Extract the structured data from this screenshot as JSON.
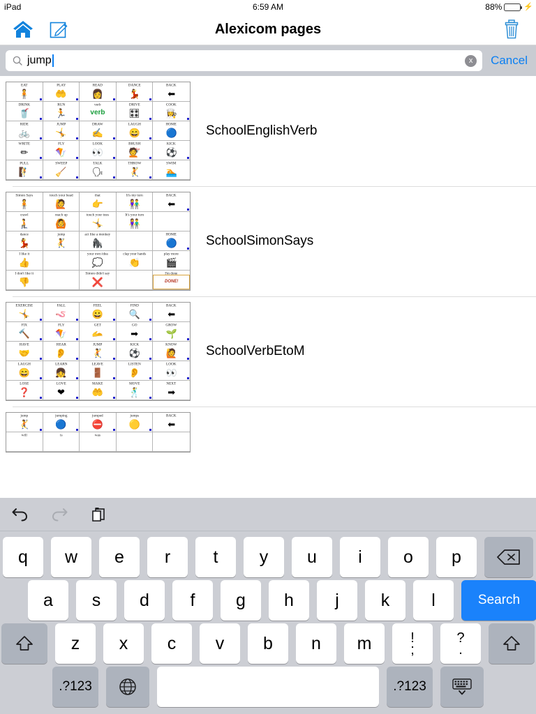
{
  "status_bar": {
    "device": "iPad",
    "time": "6:59 AM",
    "battery_percent": "88%",
    "charging_icon": "lightning-bolt-icon"
  },
  "nav_bar": {
    "title": "Alexicom pages",
    "home_icon": "home-icon",
    "edit_icon": "edit-compose-icon",
    "delete_icon": "trash-icon"
  },
  "search": {
    "value": "jump",
    "placeholder": "Search",
    "search_icon": "search-icon",
    "clear_icon": "clear-circle-icon",
    "clear_label": "x",
    "cancel_label": "Cancel"
  },
  "results": [
    {
      "title": "SchoolEnglishVerb",
      "cells": [
        {
          "label": "EAT",
          "art": "🧍",
          "dot": true
        },
        {
          "label": "PLAY",
          "art": "🤲",
          "dot": true
        },
        {
          "label": "READ",
          "art": "👩",
          "dot": true
        },
        {
          "label": "DANCE",
          "art": "💃",
          "dot": true
        },
        {
          "label": "BACK",
          "art": "⬅",
          "dot": false
        },
        {
          "label": "DRINK",
          "art": "🥤",
          "dot": true
        },
        {
          "label": "RUN",
          "art": "🏃",
          "dot": true
        },
        {
          "label": "verb",
          "art": "verb",
          "dot": false
        },
        {
          "label": "DRIVE",
          "art": "🎛",
          "dot": true
        },
        {
          "label": "COOK",
          "art": "👩‍🍳",
          "dot": true
        },
        {
          "label": "RIDE",
          "art": "🚲",
          "dot": true
        },
        {
          "label": "JUMP",
          "art": "🤸",
          "dot": true
        },
        {
          "label": "DRAW",
          "art": "✍",
          "dot": true
        },
        {
          "label": "LAUGH",
          "art": "😄",
          "dot": true
        },
        {
          "label": "HOME",
          "art": "🔵",
          "dot": false
        },
        {
          "label": "WRITE",
          "art": "✏",
          "dot": true
        },
        {
          "label": "FLY",
          "art": "🪁",
          "dot": true
        },
        {
          "label": "LOOK",
          "art": "👀",
          "dot": true
        },
        {
          "label": "BRUSH",
          "art": "💇",
          "dot": true
        },
        {
          "label": "KICK",
          "art": "⚽",
          "dot": true
        },
        {
          "label": "PULL",
          "art": "🧗",
          "dot": true
        },
        {
          "label": "SWEEP",
          "art": "🧹",
          "dot": true
        },
        {
          "label": "TALK",
          "art": "🗣",
          "dot": true
        },
        {
          "label": "THROW",
          "art": "🤾",
          "dot": true
        },
        {
          "label": "SWIM",
          "art": "🏊",
          "dot": false
        }
      ]
    },
    {
      "title": "SchoolSimonSays",
      "cells": [
        {
          "label": "Simon Says",
          "art": "🧍",
          "dot": false
        },
        {
          "label": "touch your head",
          "art": "🙋",
          "dot": false
        },
        {
          "label": "that",
          "art": "👉",
          "dot": false
        },
        {
          "label": "It's my turn",
          "art": "👫",
          "dot": false
        },
        {
          "label": "BACK",
          "art": "⬅",
          "dot": true
        },
        {
          "label": "crawl",
          "art": "🧎",
          "dot": false
        },
        {
          "label": "reach up",
          "art": "🙆",
          "dot": false
        },
        {
          "label": "touch your toes",
          "art": "🤸",
          "dot": false
        },
        {
          "label": "It's your turn",
          "art": "👫",
          "dot": false
        },
        {
          "label": "",
          "art": "",
          "dot": false
        },
        {
          "label": "dance",
          "art": "💃",
          "dot": false
        },
        {
          "label": "jump",
          "art": "🤾",
          "dot": false
        },
        {
          "label": "act like a monkey",
          "art": "🦍",
          "dot": false
        },
        {
          "label": "",
          "art": "",
          "dot": false
        },
        {
          "label": "HOME",
          "art": "🔵",
          "dot": true
        },
        {
          "label": "I like it",
          "art": "👍",
          "dot": false
        },
        {
          "label": "",
          "art": "",
          "dot": false
        },
        {
          "label": "your own idea",
          "art": "💭",
          "dot": false
        },
        {
          "label": "clap your hands",
          "art": "👏",
          "dot": false
        },
        {
          "label": "play more",
          "art": "🎬",
          "dot": false
        },
        {
          "label": "I don't like it",
          "art": "👎",
          "dot": false
        },
        {
          "label": "",
          "art": "",
          "dot": false
        },
        {
          "label": "Simon didn't say",
          "art": "❌",
          "dot": false
        },
        {
          "label": "",
          "art": "",
          "dot": false
        },
        {
          "label": "I'm done",
          "art": "DONE!",
          "dot": false
        }
      ]
    },
    {
      "title": "SchoolVerbEtoM",
      "cells": [
        {
          "label": "EXERCISE",
          "art": "🤸",
          "dot": true
        },
        {
          "label": "FALL",
          "art": "🪱",
          "dot": true
        },
        {
          "label": "FEEL",
          "art": "😀",
          "dot": true
        },
        {
          "label": "FIND",
          "art": "🔍",
          "dot": true
        },
        {
          "label": "BACK",
          "art": "⬅",
          "dot": false
        },
        {
          "label": "FIX",
          "art": "🔨",
          "dot": true
        },
        {
          "label": "FLY",
          "art": "🪁",
          "dot": true
        },
        {
          "label": "GET",
          "art": "🫴",
          "dot": true
        },
        {
          "label": "GO",
          "art": "➡",
          "dot": true
        },
        {
          "label": "GROW",
          "art": "🌱",
          "dot": true
        },
        {
          "label": "HAVE",
          "art": "🤝",
          "dot": true
        },
        {
          "label": "HEAR",
          "art": "👂",
          "dot": true
        },
        {
          "label": "JUMP",
          "art": "🤾",
          "dot": true
        },
        {
          "label": "KICK",
          "art": "⚽",
          "dot": true
        },
        {
          "label": "KNOW",
          "art": "🙋",
          "dot": true
        },
        {
          "label": "LAUGH",
          "art": "😄",
          "dot": true
        },
        {
          "label": "LEARN",
          "art": "👧",
          "dot": true
        },
        {
          "label": "LEAVE",
          "art": "🚪",
          "dot": true
        },
        {
          "label": "LISTEN",
          "art": "👂",
          "dot": true
        },
        {
          "label": "LOOK",
          "art": "👀",
          "dot": true
        },
        {
          "label": "LOSE",
          "art": "❓",
          "dot": true
        },
        {
          "label": "LOVE",
          "art": "❤",
          "dot": true
        },
        {
          "label": "MAKE",
          "art": "🤲",
          "dot": true
        },
        {
          "label": "MOVE",
          "art": "🕺",
          "dot": true
        },
        {
          "label": "NEXT",
          "art": "➡",
          "dot": false
        }
      ]
    },
    {
      "title": "",
      "cells": [
        {
          "label": "jump",
          "art": "🤾",
          "dot": true
        },
        {
          "label": "jumping",
          "art": "🔵",
          "dot": true
        },
        {
          "label": "jumped",
          "art": "⛔",
          "dot": true
        },
        {
          "label": "jumps",
          "art": "🟡",
          "dot": true
        },
        {
          "label": "BACK",
          "art": "⬅",
          "dot": false
        },
        {
          "label": "will",
          "art": "",
          "dot": false
        },
        {
          "label": "is",
          "art": "",
          "dot": false
        },
        {
          "label": "was",
          "art": "",
          "dot": false
        },
        {
          "label": "",
          "art": "",
          "dot": false
        },
        {
          "label": "",
          "art": "",
          "dot": false
        }
      ]
    }
  ],
  "keyboard": {
    "toolbar": {
      "undo_icon": "undo-arrow-icon",
      "redo_icon": "redo-arrow-icon",
      "paste_icon": "paste-clipboard-icon"
    },
    "row1": [
      "q",
      "w",
      "e",
      "r",
      "t",
      "y",
      "u",
      "i",
      "o",
      "p"
    ],
    "backspace_icon": "backspace-delete-icon",
    "row2": [
      "a",
      "s",
      "d",
      "f",
      "g",
      "h",
      "j",
      "k",
      "l"
    ],
    "search_key_label": "Search",
    "row3": [
      "z",
      "x",
      "c",
      "v",
      "b",
      "n",
      "m"
    ],
    "punct_keys": [
      {
        "top": "!",
        "bot": ";"
      },
      {
        "top": "?",
        "bot": "."
      }
    ],
    "shift_icon": "shift-arrow-icon",
    "numeric_label": ".?123",
    "globe_icon": "globe-language-icon",
    "space_label": "",
    "dismiss_icon": "hide-keyboard-icon"
  },
  "colors": {
    "accent_blue": "#0a7ff2",
    "key_blue": "#1a82fb",
    "keyboard_bg": "#ccced4",
    "search_bar_bg": "#c9ccd2",
    "battery_green": "#4cd964"
  }
}
